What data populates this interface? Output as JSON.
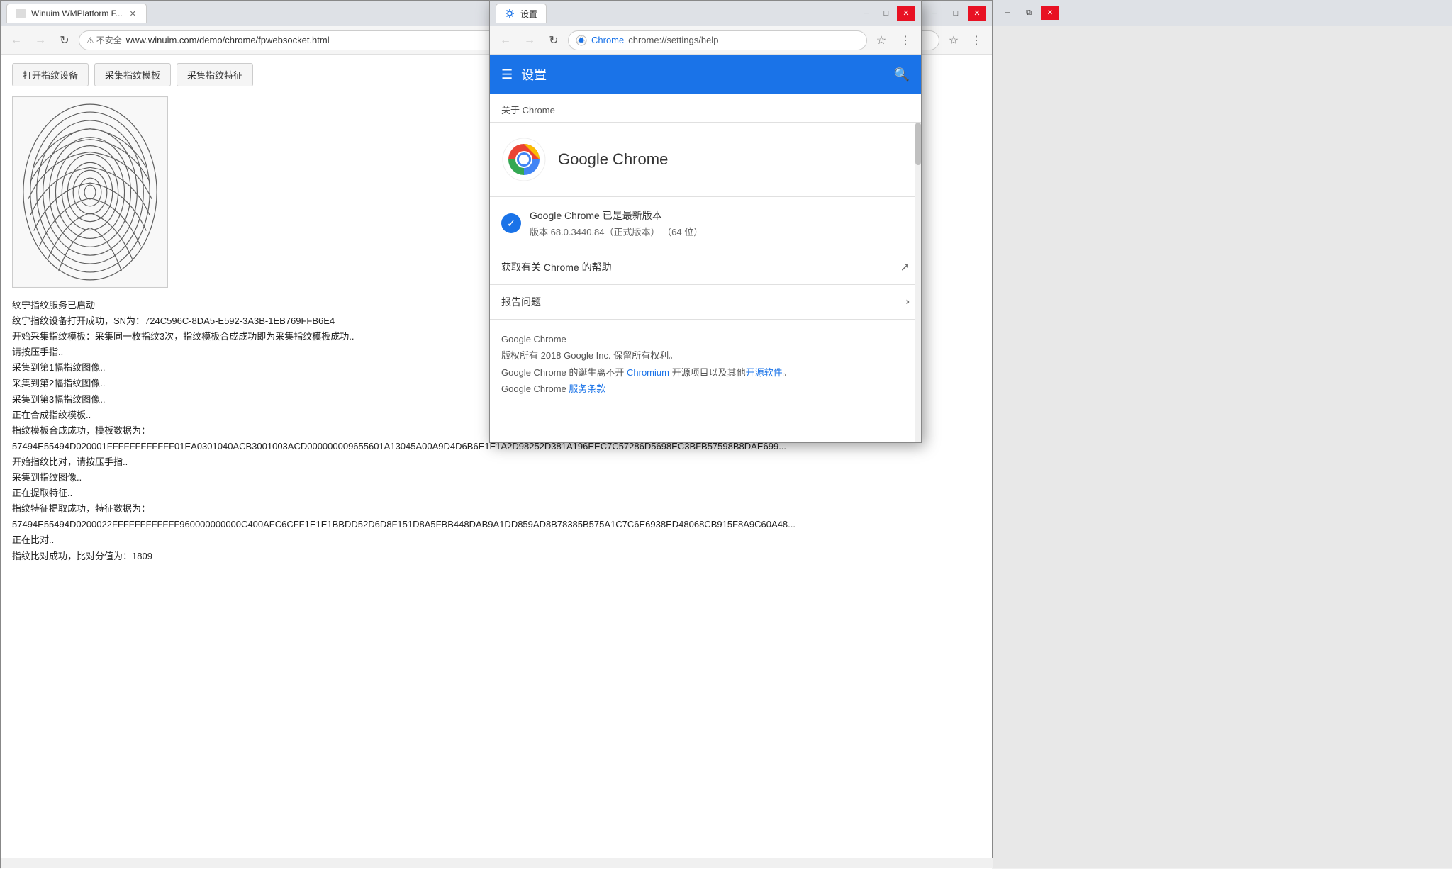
{
  "mainBrowser": {
    "tab": {
      "title": "Winuim WMPlatform F..."
    },
    "toolbar": {
      "url": "www.winuim.com/demo/chrome/fpwebsocket.html",
      "notSecure": "不安全"
    },
    "buttons": [
      {
        "label": "打开指纹设备"
      },
      {
        "label": "采集指纹模板"
      },
      {
        "label": "采集指纹特征"
      }
    ],
    "logs": [
      {
        "text": "纹宁指纹服务已启动",
        "class": ""
      },
      {
        "text": "纹宁指纹设备打开成功，SN为：724C596C-8DA5-E592-3A3B-1EB769FFB6E4",
        "class": ""
      },
      {
        "text": "开始采集指纹模板：采集同一枚指纹3次，指纹模板合成成功即为采集指纹模板成功..",
        "class": ""
      },
      {
        "text": "请按压手指..",
        "class": ""
      },
      {
        "text": "采集到第1幅指纹图像..",
        "class": ""
      },
      {
        "text": "采集到第2幅指纹图像..",
        "class": ""
      },
      {
        "text": "采集到第3幅指纹图像..",
        "class": ""
      },
      {
        "text": "正在合成指纹模板..",
        "class": ""
      },
      {
        "text": "指纹模板合成成功，模板数据为：",
        "class": ""
      },
      {
        "text": "57494E55494D020001FFFFFFFFFFFF01EA0301040ACB3001003ACD000000009655601A13045A00A9D4D6B6E1E1A2D98252D381A196EEC7C57286D5698EC3BFB57598B8DAE699...",
        "class": "hex"
      },
      {
        "text": "开始指纹比对，请按压手指..",
        "class": ""
      },
      {
        "text": "采集到指纹图像..",
        "class": ""
      },
      {
        "text": "正在提取特征..",
        "class": ""
      },
      {
        "text": "指纹特征提取成功，特征数据为：",
        "class": ""
      },
      {
        "text": "57494E55494D0200022FFFFFFFFFFFF960000000000C400AFC6CFF1E1E1BBDD52D6D8F151D8A5FBB448DAB9A1DD859AD8B78385B575A1C7C6E6938ED48068CB915F8A9C60A48...",
        "class": "hex"
      },
      {
        "text": "正在比对..",
        "class": ""
      },
      {
        "text": "指纹比对成功，比对分值为：1809",
        "class": ""
      }
    ]
  },
  "settingsWindow": {
    "tab": {
      "title": "设置"
    },
    "toolbar": {
      "url": "chrome://settings/help",
      "chromeLabel": "Chrome"
    },
    "header": {
      "menuIcon": "☰",
      "title": "设置",
      "searchIcon": "🔍"
    },
    "sectionTitle": "关于 Chrome",
    "chromeInfo": {
      "title": "Google Chrome"
    },
    "updateStatus": {
      "checkText": "✓",
      "mainText": "Google Chrome 已是最新版本",
      "versionText": "版本 68.0.3440.84（正式版本） （64 位）"
    },
    "menuItems": [
      {
        "label": "获取有关 Chrome 的帮助",
        "type": "external"
      },
      {
        "label": "报告问题",
        "type": "arrow"
      }
    ],
    "footer": {
      "line1": "Google Chrome",
      "line2": "版权所有 2018 Google Inc. 保留所有权利。",
      "line3prefix": "Google Chrome 的诞生离不开 ",
      "link1": "Chromium",
      "line3middle": " 开源项目以及其他",
      "link2": "开源软件",
      "line3suffix": "。",
      "line4prefix": "Google Chrome   ",
      "link3": "服务条款"
    }
  },
  "controls": {
    "minimize": "─",
    "restore": "□",
    "close": "✕",
    "back": "←",
    "forward": "→",
    "reload": "↻"
  }
}
